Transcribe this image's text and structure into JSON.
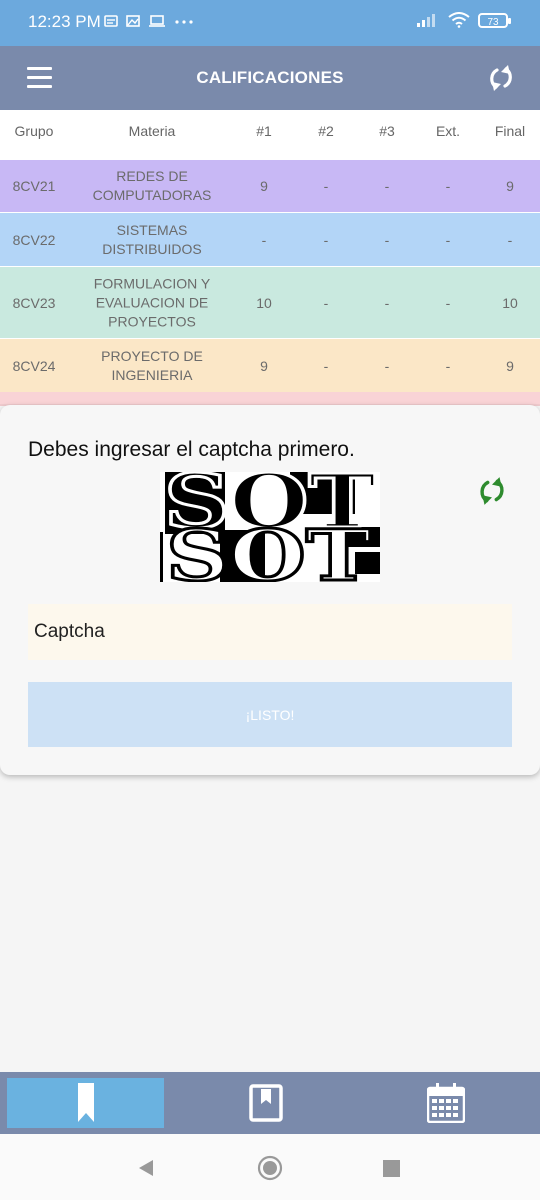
{
  "status_bar": {
    "time": "12:23 PM",
    "battery": "73"
  },
  "app_bar": {
    "title": "CALIFICACIONES"
  },
  "table": {
    "columns": [
      "Grupo",
      "Materia",
      "#1",
      "#2",
      "#3",
      "Ext.",
      "Final"
    ],
    "rows": [
      {
        "grupo": "8CV21",
        "materia": "REDES DE\nCOMPUTADORAS",
        "c1": "9",
        "c2": "-",
        "c3": "-",
        "ext": "-",
        "final": "9",
        "color": "#c8b8f5"
      },
      {
        "grupo": "8CV22",
        "materia": "SISTEMAS\nDISTRIBUIDOS",
        "c1": "-",
        "c2": "-",
        "c3": "-",
        "ext": "-",
        "final": "-",
        "color": "#b3d5f7"
      },
      {
        "grupo": "8CV23",
        "materia": "FORMULACION Y\nEVALUACION DE\nPROYECTOS",
        "c1": "10",
        "c2": "-",
        "c3": "-",
        "ext": "-",
        "final": "10",
        "color": "#c9e9df"
      },
      {
        "grupo": "8CV24",
        "materia": "PROYECTO DE\nINGENIERIA",
        "c1": "9",
        "c2": "-",
        "c3": "-",
        "ext": "-",
        "final": "9",
        "color": "#fbe7c7"
      }
    ]
  },
  "dialog": {
    "message": "Debes ingresar el captcha primero.",
    "captcha_text": "SOT",
    "input_placeholder": "Captcha",
    "button_label": "¡LISTO!"
  },
  "bottom_nav": {
    "tabs": [
      {
        "icon": "bookmark-icon",
        "active": true
      },
      {
        "icon": "book-icon",
        "active": false
      },
      {
        "icon": "calendar-icon",
        "active": false
      }
    ]
  },
  "colors": {
    "status_bar": "#6ca9dd",
    "app_bar": "#7a8aab",
    "accent_green": "#2e8b2e",
    "button": "#cde1f5"
  }
}
